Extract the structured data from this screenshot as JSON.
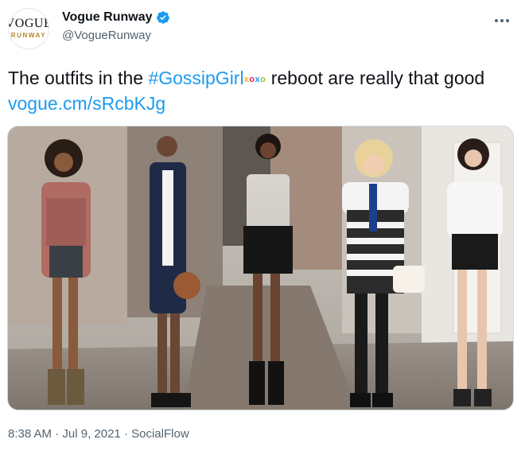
{
  "account": {
    "display_name": "Vogue Runway",
    "handle": "@VogueRunway",
    "avatar": {
      "logo_top": "VOGUE",
      "logo_bottom": "RUNWAY"
    },
    "verified_icon": "verified-badge-icon"
  },
  "tweet": {
    "text_before": "The outfits in the ",
    "hashtag": "#GossipGirl",
    "hashflag": {
      "x1": "x",
      "o1": "o",
      "x2": "x",
      "o2": "o"
    },
    "text_after": " reboot are really that good ",
    "link": "vogue.cm/sRcbKJg"
  },
  "media": {
    "icon": "photo"
  },
  "meta": {
    "time": "8:38 AM",
    "separator": " · ",
    "date": "Jul 9, 2021",
    "source": "SocialFlow"
  },
  "colors": {
    "link": "#1d9bf0",
    "secondary_text": "#536471",
    "verified": "#1d9bf0"
  }
}
